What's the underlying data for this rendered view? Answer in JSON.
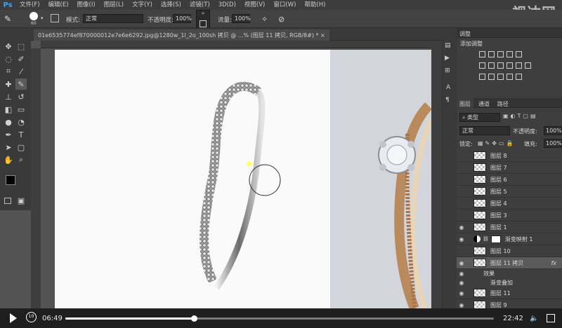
{
  "app": {
    "logo": "Ps",
    "watermark": "视达网"
  },
  "menu": [
    "文件(F)",
    "编辑(E)",
    "图像(I)",
    "图层(L)",
    "文字(Y)",
    "选择(S)",
    "滤镜(T)",
    "3D(D)",
    "视图(V)",
    "窗口(W)",
    "帮助(H)"
  ],
  "options": {
    "brush_size": "60",
    "mode_label": "模式:",
    "mode_value": "正常",
    "opacity_label": "不透明度:",
    "opacity_value": "100%",
    "flow_label": "流量:",
    "flow_value": "100%"
  },
  "document": {
    "tab_title": "01e6535774ef870000012e7e6e6292.jpg@1280w_1l_2o_100sh 拷贝 @ ...% (图层 11 拷贝, RGB/8#) *",
    "close_label": "×"
  },
  "panel": {
    "adjust_tab": "调整",
    "adjust_title": "添加调整",
    "layers_tabs": [
      "图层",
      "通道",
      "路径"
    ],
    "kind_label": "类型",
    "blend_mode": "正常",
    "opacity_label": "不透明度:",
    "opacity_value": "100%",
    "lock_label": "锁定:",
    "fill_label": "填充:",
    "fill_value": "100%",
    "layers": [
      {
        "name": "图层 8",
        "visible": false
      },
      {
        "name": "图层 7",
        "visible": false
      },
      {
        "name": "图层 6",
        "visible": false
      },
      {
        "name": "图层 5",
        "visible": false
      },
      {
        "name": "图层 4",
        "visible": false
      },
      {
        "name": "图层 3",
        "visible": false
      },
      {
        "name": "图层 1",
        "visible": true
      },
      {
        "name": "渐变映射 1",
        "visible": true
      },
      {
        "name": "图层 10",
        "visible": false
      },
      {
        "name": "图层 11 拷贝",
        "visible": true,
        "fx": "fx"
      },
      {
        "name": "效果",
        "visible": true
      },
      {
        "name": "渐变叠加",
        "visible": true
      },
      {
        "name": "图层 11",
        "visible": true
      },
      {
        "name": "图层 9",
        "visible": true
      }
    ]
  },
  "video": {
    "current_time": "06:49",
    "total_time": "22:42",
    "progress": 0.3,
    "rewind_label": "10"
  }
}
